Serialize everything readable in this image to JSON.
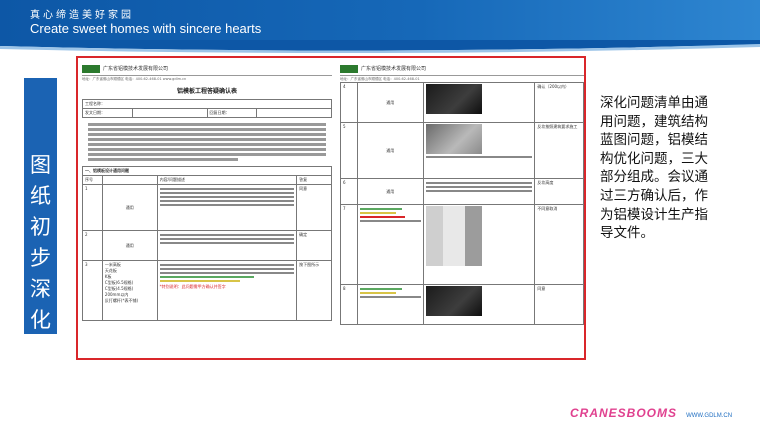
{
  "header": {
    "tagline_cn": "真心缔造美好家园",
    "tagline_en": "Create sweet homes with sincere hearts"
  },
  "side_title": {
    "chars": [
      "图",
      "纸",
      "初",
      "步",
      "深",
      "化"
    ]
  },
  "document": {
    "left_page": {
      "company": "广东省铝模技术发展有限公司",
      "address_line": "地址：广东省佛山市顺德区 电话：400-62-468-01   www.gdlm.cn",
      "form_title": "铝模板工程答疑确认表",
      "project_label": "工程名称：",
      "party_a": "发文日期：",
      "party_b": "回复日期：",
      "section1": "一、铝模板设计通用问题",
      "col_no": "序号",
      "col_item": "内容/问题描述",
      "col_reply": "答复",
      "rows": [
        {
          "no": "1",
          "type": "通用",
          "reply": "同意"
        },
        {
          "no": "2",
          "type": "通用",
          "reply": "确定"
        },
        {
          "no": "3",
          "type": "通用",
          "reply": "按下图所示"
        }
      ],
      "legend": [
        "一米高板",
        "天花板",
        "K板",
        "C型板(6.5规格)",
        "C型板(4.5规格)",
        "200mm以内",
        "反打螺杆(*表不铺)"
      ],
      "red_note": "*特别说明：此问题需甲方确认并签字"
    },
    "right_page": {
      "company": "广东省铝模技术发展有限公司",
      "address_line": "地址：广东省佛山市顺德区 电话：400-62-468-01",
      "rows": [
        {
          "no": "4",
          "type": "通用",
          "reply": "确认（200以内）"
        },
        {
          "no": "5",
          "type": "通用",
          "reply": "反坎按照建筑要求施工"
        },
        {
          "no": "6",
          "type": "通用",
          "reply": "反坎高度"
        },
        {
          "no": "7",
          "type": "通用",
          "reply": "不同意取消"
        },
        {
          "no": "8",
          "type": "通用",
          "reply": "同意"
        }
      ]
    }
  },
  "description": "深化问题清单由通用问题，建筑结构蓝图问题，铝模结构优化问题，三大部分组成。会议通过三方确认后，作为铝模设计生产指导文件。",
  "footer": {
    "brand": "CRANESBOOMS",
    "sub": "WWW.GDLM.CN"
  }
}
